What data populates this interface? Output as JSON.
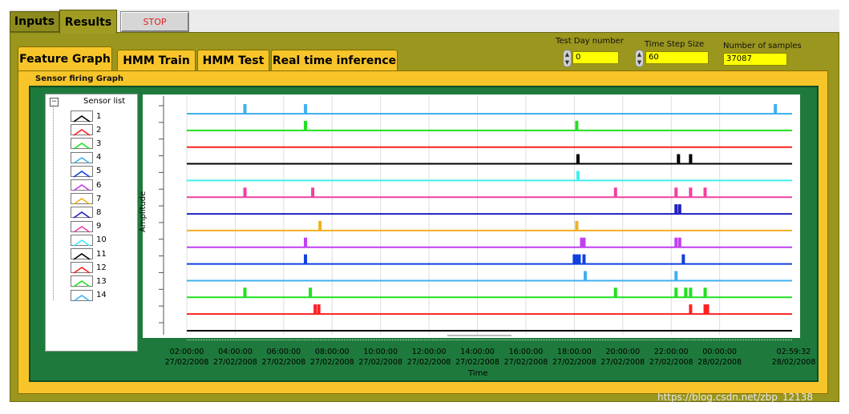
{
  "tabs": {
    "inputs": "Inputs",
    "results": "Results"
  },
  "stop_button": "STOP",
  "subtabs": [
    "Feature Graph",
    "HMM Train",
    "HMM Test",
    "Real time inference"
  ],
  "controls": {
    "test_day": {
      "label": "Test Day number",
      "value": "0"
    },
    "time_step": {
      "label": "Time Step Size",
      "value": "60"
    },
    "num_samples": {
      "label": "Number of samples",
      "value": "37087"
    }
  },
  "graph_label": "Sensor firing Graph",
  "sensor_list": {
    "title": "Sensor list",
    "items": [
      {
        "label": "1",
        "color": "#000000"
      },
      {
        "label": "2",
        "color": "#ff2020"
      },
      {
        "label": "3",
        "color": "#20e020"
      },
      {
        "label": "4",
        "color": "#40b0f0"
      },
      {
        "label": "5",
        "color": "#1040e0"
      },
      {
        "label": "6",
        "color": "#c040f0"
      },
      {
        "label": "7",
        "color": "#f0b020"
      },
      {
        "label": "8",
        "color": "#2020c0"
      },
      {
        "label": "9",
        "color": "#f040a0"
      },
      {
        "label": "10",
        "color": "#40f0f0"
      },
      {
        "label": "11",
        "color": "#000000"
      },
      {
        "label": "12",
        "color": "#ff2020"
      },
      {
        "label": "13",
        "color": "#20e020"
      },
      {
        "label": "14",
        "color": "#40b0f0"
      }
    ]
  },
  "chart_data": {
    "type": "line",
    "xlabel": "Time",
    "ylabel": "Amplitude",
    "x_ticks": [
      {
        "time": "02:00:00",
        "date": "27/02/2008"
      },
      {
        "time": "04:00:00",
        "date": "27/02/2008"
      },
      {
        "time": "06:00:00",
        "date": "27/02/2008"
      },
      {
        "time": "08:00:00",
        "date": "27/02/2008"
      },
      {
        "time": "10:00:00",
        "date": "27/02/2008"
      },
      {
        "time": "12:00:00",
        "date": "27/02/2008"
      },
      {
        "time": "14:00:00",
        "date": "27/02/2008"
      },
      {
        "time": "16:00:00",
        "date": "27/02/2008"
      },
      {
        "time": "18:00:00",
        "date": "27/02/2008"
      },
      {
        "time": "20:00:00",
        "date": "27/02/2008"
      },
      {
        "time": "22:00:00",
        "date": "27/02/2008"
      },
      {
        "time": "00:00:00",
        "date": "28/02/2008"
      },
      {
        "time": "02:59:32",
        "date": "28/02/2008"
      }
    ],
    "x_range_hours": [
      2,
      26.99
    ],
    "grid": true,
    "series": [
      {
        "color": "#40b0f0",
        "pulses": [
          4.4,
          6.9,
          26.3
        ]
      },
      {
        "color": "#20e020",
        "pulses": [
          6.9,
          18.1
        ]
      },
      {
        "color": "#ff2020",
        "pulses": []
      },
      {
        "color": "#000000",
        "pulses": [
          18.15,
          22.3,
          22.8
        ]
      },
      {
        "color": "#40f0f0",
        "pulses": [
          18.15
        ]
      },
      {
        "color": "#f040a0",
        "pulses": [
          4.4,
          7.2,
          19.7,
          22.2,
          22.8,
          23.4
        ]
      },
      {
        "color": "#2020c0",
        "pulses": [
          22.2,
          22.35
        ]
      },
      {
        "color": "#f0b020",
        "pulses": [
          7.5,
          18.1
        ]
      },
      {
        "color": "#c040f0",
        "pulses": [
          6.9,
          18.3,
          18.4,
          22.2,
          22.35
        ]
      },
      {
        "color": "#1040e0",
        "pulses": [
          6.9,
          18.0,
          18.1,
          18.2,
          18.4,
          22.5
        ]
      },
      {
        "color": "#40b0f0",
        "pulses": [
          18.45,
          22.2
        ]
      },
      {
        "color": "#20e020",
        "pulses": [
          4.4,
          7.1,
          19.7,
          22.2,
          22.6,
          22.8,
          23.4
        ]
      },
      {
        "color": "#ff2020",
        "pulses": [
          7.3,
          7.45,
          22.8,
          23.4,
          23.5
        ]
      },
      {
        "color": "#000000",
        "pulses": []
      }
    ]
  },
  "watermark": "https://blog.csdn.net/zbp_12138"
}
